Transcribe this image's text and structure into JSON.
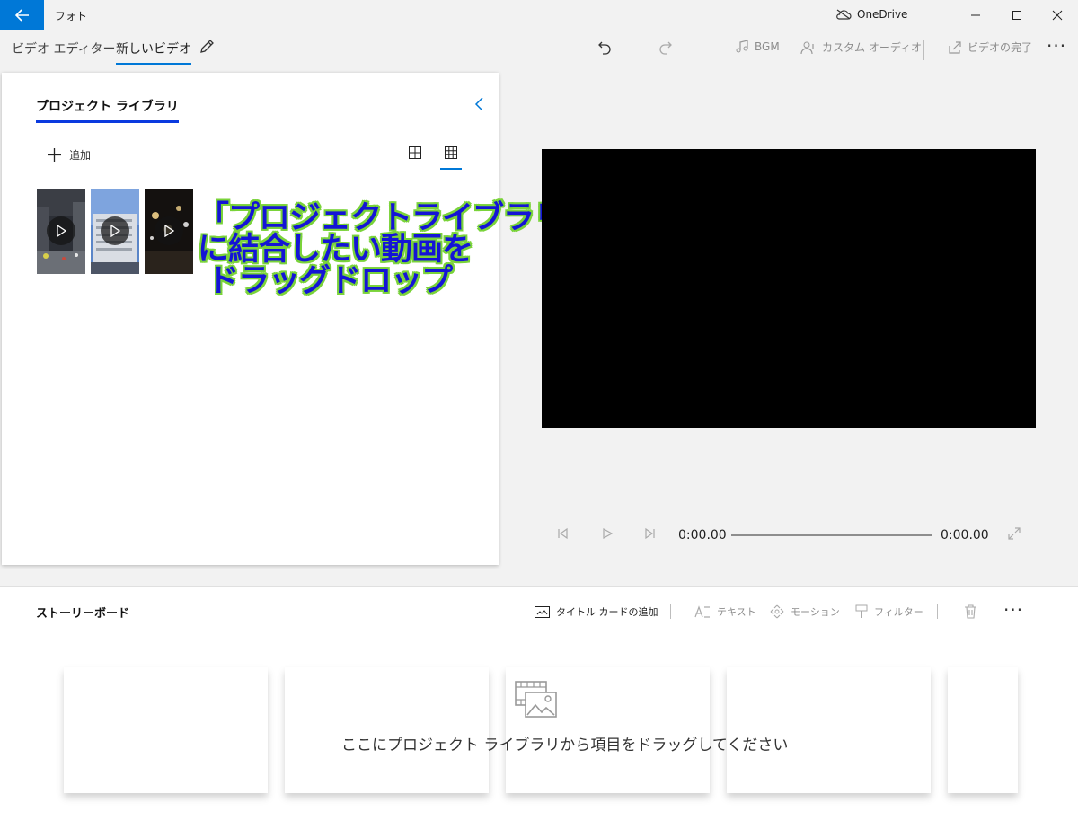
{
  "app": {
    "title": "フォト",
    "onedrive_label": "OneDrive"
  },
  "breadcrumb": {
    "root": "ビデオ エディター",
    "separator": "›",
    "current": "新しいビデオ"
  },
  "toolbar": {
    "bgm": "BGM",
    "custom_audio": "カスタム オーディオ",
    "finish_video": "ビデオの完了",
    "more": "···"
  },
  "library": {
    "title": "プロジェクト ライブラリ",
    "add_label": "追加",
    "view_mode": "small-grid",
    "thumbnails": [
      {
        "name": "city-street-night"
      },
      {
        "name": "building-blue-sky"
      },
      {
        "name": "night-lights"
      }
    ]
  },
  "annotation": {
    "text": "「プロジェクトライブラリ」\nに結合したい動画を\n ドラッグドロップ"
  },
  "player": {
    "current_time": "0:00.00",
    "total_time": "0:00.00"
  },
  "storyboard": {
    "title": "ストーリーボード",
    "add_title_card": "タイトル カードの追加",
    "text": "テキスト",
    "motion": "モーション",
    "filter": "フィルター",
    "more": "···",
    "drop_hint": "ここにプロジェクト ライブラリから項目をドラッグしてください"
  },
  "colors": {
    "accent": "#0078d7",
    "annotation_text": "#1414d6",
    "annotation_outline": "#7ad33a"
  }
}
